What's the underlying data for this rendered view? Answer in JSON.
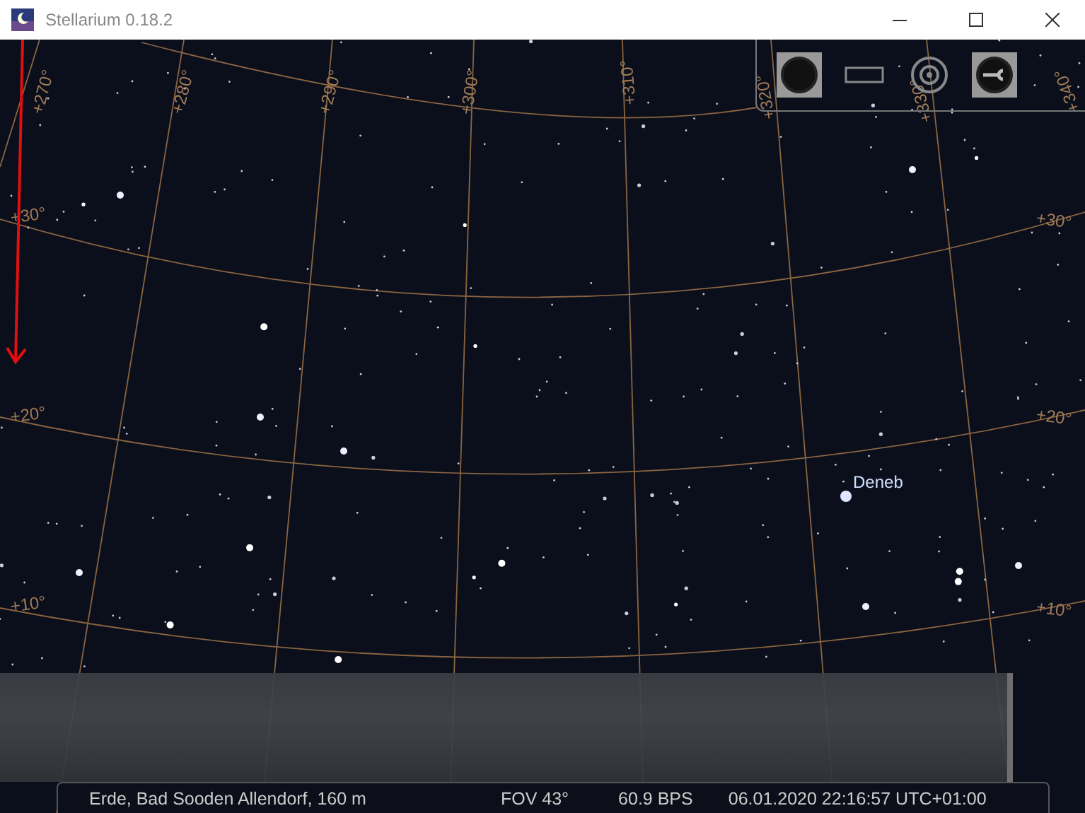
{
  "window": {
    "title": "Stellarium 0.18.2"
  },
  "sky": {
    "grid_labels": [
      "+270°",
      "+280°",
      "+290°",
      "+300°",
      "+310°",
      "+320°",
      "+330°",
      "+340°",
      "+30°",
      "+20°",
      "+10°",
      "+30°",
      "+20°",
      "+10°"
    ],
    "star_labels": [
      "Deneb"
    ]
  },
  "toolbar": [
    {
      "kind": "disc",
      "on": true
    },
    {
      "kind": "rect",
      "on": false
    },
    {
      "kind": "target",
      "on": false
    },
    {
      "kind": "wrench",
      "on": true
    }
  ],
  "status_bar": {
    "location": "Erde, Bad Sooden Allendorf, 160 m",
    "fov": "FOV 43°",
    "fps": "60.9 BPS",
    "datetime": "06.01.2020 22:16:57 UTC+01:00"
  }
}
